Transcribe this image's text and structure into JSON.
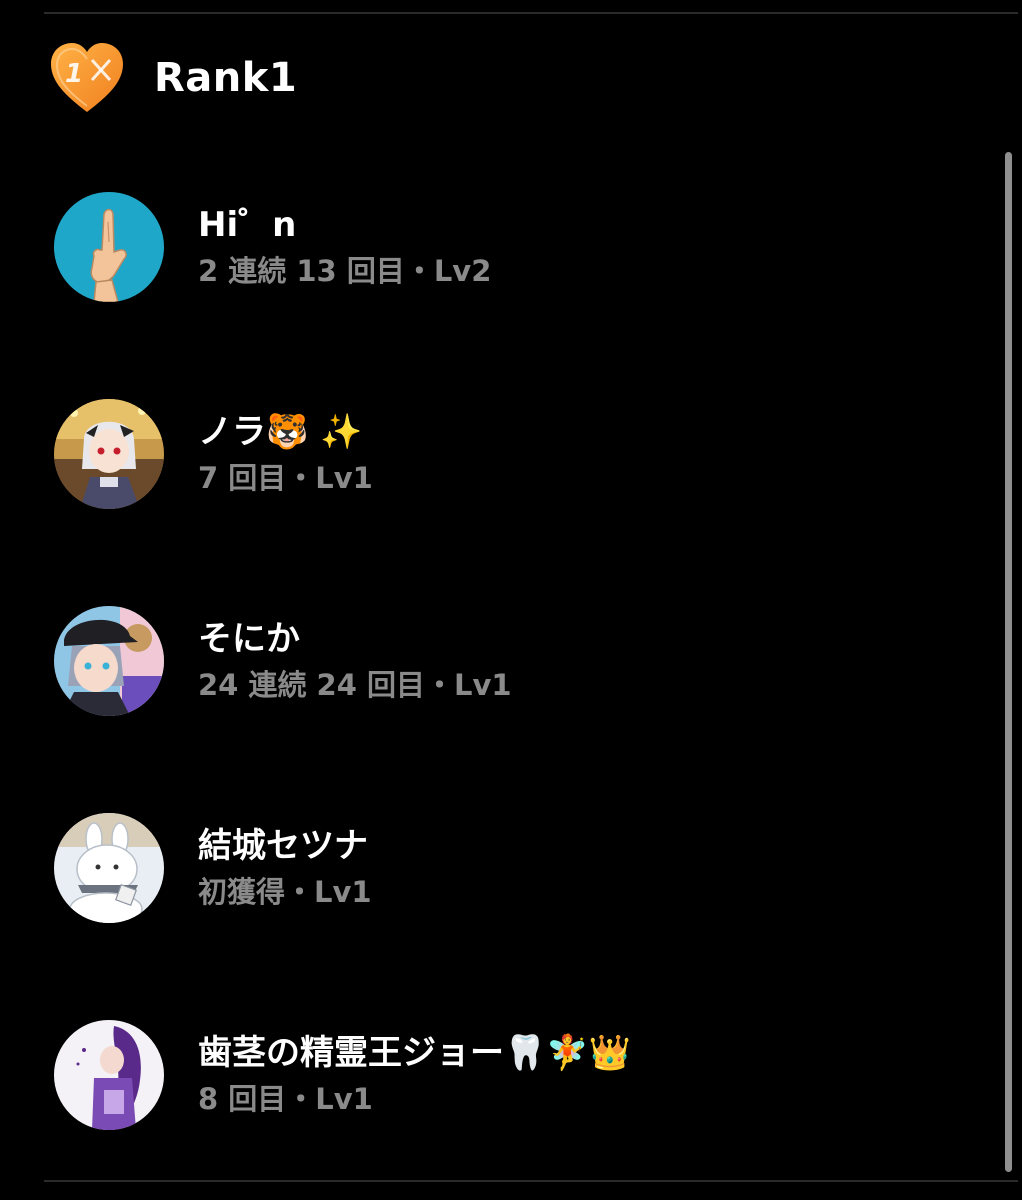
{
  "header": {
    "title": "Rank1",
    "badge_number": "1",
    "badge_color": "#f5922b"
  },
  "users": [
    {
      "name": "Hi゜n",
      "detail": "2 連続 13 回目・Lv2",
      "avatar_icon": "pointing-finger-avatar",
      "avatar_bg": "#1ea7c9"
    },
    {
      "name": "ノラ🐯 ✨",
      "detail": "7 回目・Lv1",
      "avatar_icon": "anime-girl-avatar",
      "avatar_bg": "#c79a4b"
    },
    {
      "name": "そにか",
      "detail": "24 連続 24 回目・Lv1",
      "avatar_icon": "anime-boy-cap-avatar",
      "avatar_bg": "#8fc6e6"
    },
    {
      "name": "結城セツナ",
      "detail": "初獲得・Lv1",
      "avatar_icon": "white-bunny-avatar",
      "avatar_bg": "#e9eef4"
    },
    {
      "name": "歯茎の精霊王ジョー🦷🧚👑",
      "detail": "8 回目・Lv1",
      "avatar_icon": "purple-character-avatar",
      "avatar_bg": "#f4f2f6"
    }
  ]
}
